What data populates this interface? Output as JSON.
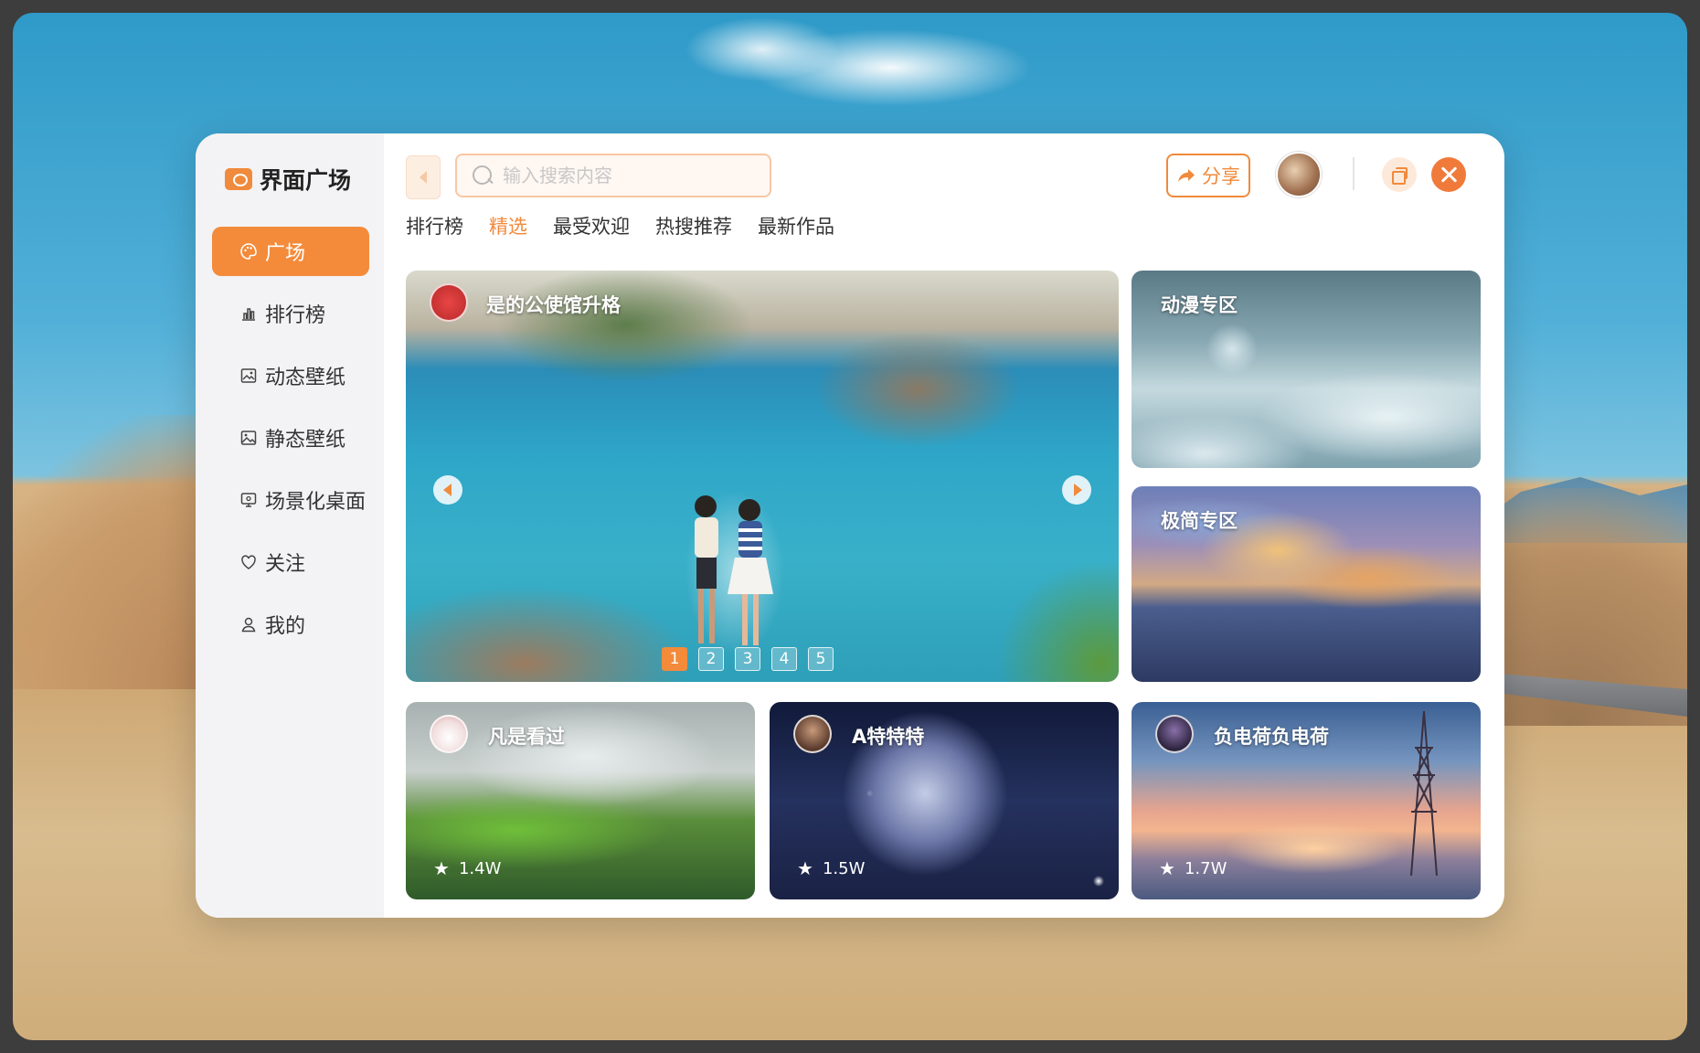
{
  "app": {
    "title": "界面广场"
  },
  "sidebar": {
    "items": [
      {
        "label": "广场",
        "icon": "palette-icon",
        "active": true
      },
      {
        "label": "排行榜",
        "icon": "bar-chart-icon",
        "active": false
      },
      {
        "label": "动态壁纸",
        "icon": "dynamic-wallpaper-icon",
        "active": false
      },
      {
        "label": "静态壁纸",
        "icon": "image-icon",
        "active": false
      },
      {
        "label": "场景化桌面",
        "icon": "desktop-icon",
        "active": false
      },
      {
        "label": "关注",
        "icon": "heart-icon",
        "active": false
      },
      {
        "label": "我的",
        "icon": "user-icon",
        "active": false
      }
    ]
  },
  "header": {
    "search_placeholder": "输入搜索内容",
    "share_label": "分享"
  },
  "tabs": [
    {
      "label": "排行榜",
      "active": false
    },
    {
      "label": "精选",
      "active": true
    },
    {
      "label": "最受欢迎",
      "active": false
    },
    {
      "label": "热搜推荐",
      "active": false
    },
    {
      "label": "最新作品",
      "active": false
    }
  ],
  "hero": {
    "title": "是的公使馆升格",
    "pages": [
      "1",
      "2",
      "3",
      "4",
      "5"
    ],
    "active_page": "1"
  },
  "side_cards": [
    {
      "title": "动漫专区"
    },
    {
      "title": "极简专区"
    }
  ],
  "bottom_cards": [
    {
      "title": "凡是看过",
      "stars": "1.4W"
    },
    {
      "title": "A特特特",
      "stars": "1.5W"
    },
    {
      "title": "负电荷负电荷",
      "stars": "1.7W"
    }
  ],
  "colors": {
    "accent": "#f08a3c",
    "sidebar_bg": "#f3f3f5"
  }
}
